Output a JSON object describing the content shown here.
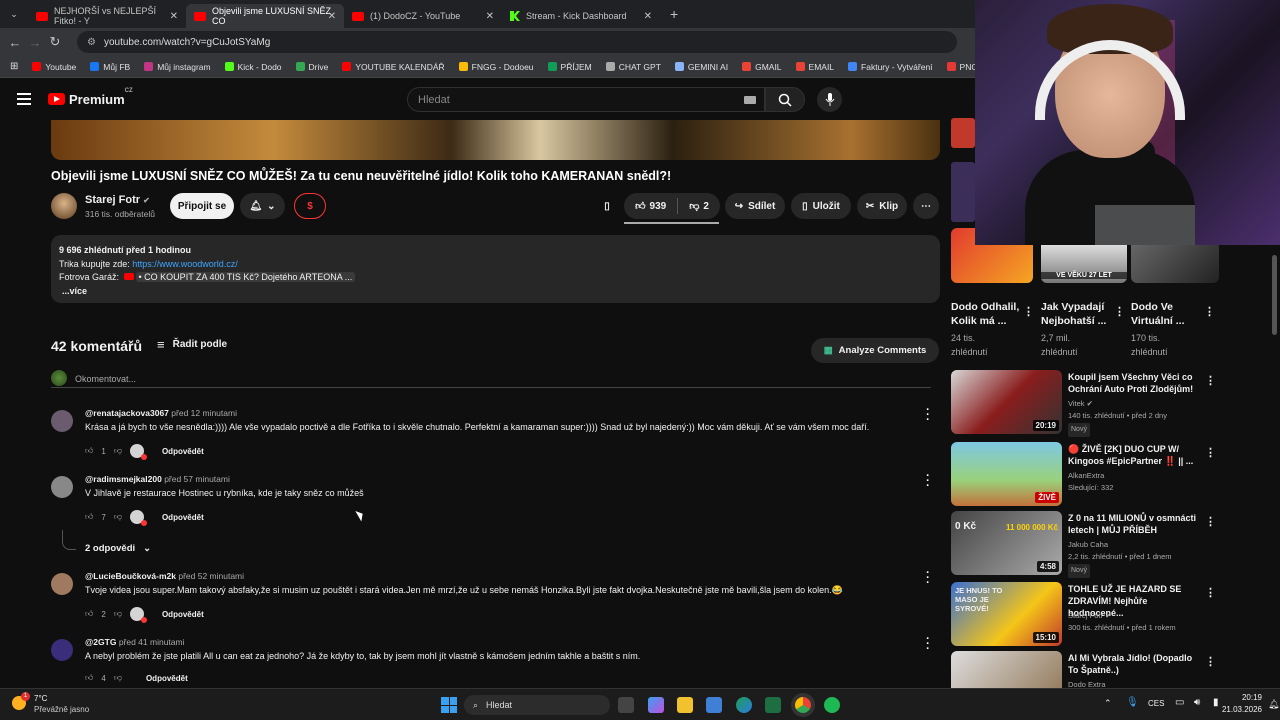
{
  "browser": {
    "tabs": [
      {
        "title": "NEJHORŠÍ vs NEJLEPŠÍ Fitko! - Y",
        "icon": "youtube"
      },
      {
        "title": "Objevili jsme LUXUSNÍ SNĚZ CO",
        "icon": "youtube",
        "active": true
      },
      {
        "title": "(1) DodoCZ - YouTube",
        "icon": "youtube"
      },
      {
        "title": "Stream - Kick Dashboard",
        "icon": "kick"
      }
    ],
    "url": "youtube.com/watch?v=gCuJotSYaMg",
    "bookmarks": [
      "Youtube",
      "Můj FB",
      "Můj instagram",
      "Kick - Dodo",
      "Drive",
      "YOUTUBE KALENDÁŘ",
      "FNGG - Dodoeu",
      "PŘÍJEM",
      "CHAT GPT",
      "GEMINI AI",
      "GMAIL",
      "EMAIL",
      "Faktury - Vytváření",
      "PNG to PDF"
    ],
    "bookmark_colors": [
      "#ff0000",
      "#1877f2",
      "#c13584",
      "#53fc18",
      "#34a853",
      "#ff0000",
      "#fbbc05",
      "#0f9d58",
      "#aaaaaa",
      "#8ab4f8",
      "#ea4335",
      "#ea4335",
      "#4285f4",
      "#e53935"
    ]
  },
  "header": {
    "logo": "Premium",
    "region": "CZ",
    "search_placeholder": "Hledat"
  },
  "video": {
    "title": "Objevili jsme LUXUSNÍ SNĚZ CO MŮŽEŠ! Za tu cenu neuvěřitelné jídlo! Kolik toho KAMERANAN snědl?!",
    "channel": "Starej Fotr",
    "subscribers": "316 tis. odběratelů",
    "join": "Připojit se",
    "likes": "939",
    "dislikes": "2",
    "share": "Sdílet",
    "save": "Uložit",
    "clip": "Klip"
  },
  "description": {
    "stats": "9 696 zhlédnutí  před 1 hodinou",
    "line1_prefix": "Trika kupujte zde: ",
    "line1_link": "https://www.woodworld.cz/",
    "line2_prefix": "Fotrova Garáž: ",
    "line2_text": "• CO KOUPIT ZA 400 TIS Kč? Dojetého ARTEONA ...",
    "more": "...více"
  },
  "comments_section": {
    "count": "42 komentářů",
    "sort": "Řadit podle",
    "analyze": "Analyze Comments",
    "add_placeholder": "Okomentovat...",
    "reply_label": "Odpovědět",
    "replies_toggle": "2 odpovědi"
  },
  "comments": [
    {
      "user": "@renatajackova3067",
      "time": "před 12 minutami",
      "text": "Krása a já bych to vše nesnědla:)))) Ale vše vypadalo poctivě a dle Fotříka to i skvěle chutnalo. Perfektní a kamaraman super:)))) Snad už byl najedený:)) Moc vám děkuji. Ať se vám všem moc daří.",
      "likes": "1"
    },
    {
      "user": "@radimsmejkal200",
      "time": "před 57 minutami",
      "text": "V Jihlavě je restaurace Hostinec u rybníka, kde je taky sněz co můžeš",
      "likes": "7"
    },
    {
      "user": "@LucieBoučková-m2k",
      "time": "před 52 minutami",
      "text": "Tvoje videa jsou super.Mam takový absfaky,že si musim uz pouštět i stará videa.Jen mě mrzí,že už u sebe nemáš Honzika.Byli jste fakt dvojka.Neskutečně jste mě bavili,šla jsem do kolen.😂",
      "likes": "2"
    },
    {
      "user": "@2GTG",
      "time": "před 41 minutami",
      "text": "A nebyl problém že jste platili All u can eat za jednoho? Já že kdyby to, tak by jsem mohl jít vlastně s kámošem jedním takhle a baštit s ním.",
      "likes": "4"
    }
  ],
  "sidebar_top": [
    {
      "title": "Dodo Odhalil, Kolik má ...",
      "meta1": "24 tis.",
      "meta2": "zhlédnutí"
    },
    {
      "title": "Jak Vypadají Nejbohatší ...",
      "meta1": "2,7 mil.",
      "meta2": "zhlédnutí",
      "thumb_text": "VE VĚKU 27 LET"
    },
    {
      "title": "Dodo Ve Virtuální ...",
      "meta1": "170 tis.",
      "meta2": "zhlédnutí"
    }
  ],
  "sidebar": [
    {
      "title": "Koupil jsem Všechny Věci co Ochrání Auto Proti Zlodějům!",
      "channel": "Vitek",
      "meta": "140 tis. zhlédnutí • před 2 dny",
      "badge": "Nový",
      "duration": "20:19"
    },
    {
      "title": "🔴 ŽIVĚ [2K] DUO CUP W/ Kingoos #EpicPartner ‼️ || ...",
      "channel": "AlkanExtra",
      "meta": "Sledující: 332",
      "badge": "",
      "duration": "ŽIVĚ"
    },
    {
      "title": "Z 0 na 11 MILIONŮ v osmnácti letech | MŮJ PŘÍBĚH",
      "channel": "Jakub Caha",
      "meta": "2,2 tis. zhlédnutí • před 1 dnem",
      "badge": "Nový",
      "duration": "4:58",
      "thumb_text": "11 000 000 Kč",
      "thumb_text2": "0 Kč"
    },
    {
      "title": "TOHLE UŽ JE HAZARD SE ZDRAVÍM! Nejhůře hodnocené...",
      "channel": "Starej Fotr",
      "meta": "300 tis. zhlédnutí • před 1 rokem",
      "badge": "",
      "duration": "15:10",
      "thumb_text": "JE HNUS! TO MASO JE SYROVÉ!"
    },
    {
      "title": "AI Mi Vybrala Jídlo! (Dopadlo To Špatně..)",
      "channel": "Dodo Extra",
      "meta": "",
      "badge": "",
      "duration": ""
    }
  ],
  "taskbar": {
    "weather_temp": "7°C",
    "weather_text": "Převážně jasno",
    "search": "Hledat",
    "lang": "CES",
    "time": "20:19",
    "date": "21.03.2026"
  }
}
